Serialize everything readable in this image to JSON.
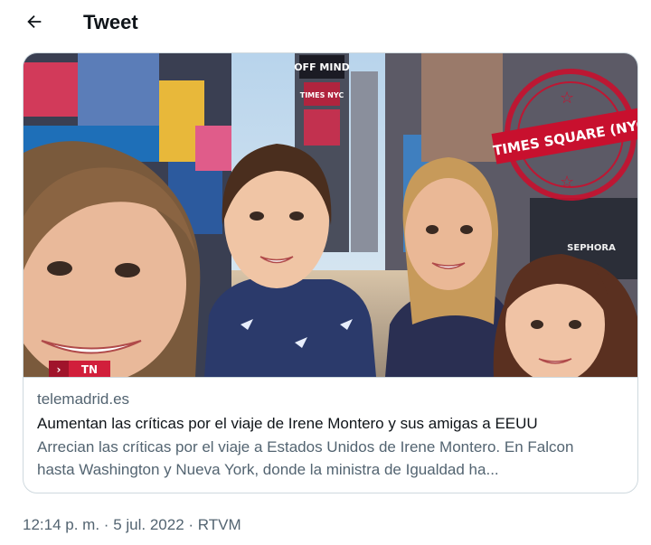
{
  "header": {
    "back_icon": "arrow-left-icon",
    "title": "Tweet"
  },
  "card": {
    "image": {
      "stamp_text": "TIMES SQUARE (NYC)",
      "sign_text_1": "OFF MIND",
      "sign_text_2": "TIMES NYC",
      "corner_logo": "TN",
      "store_sign": "SEPHORA",
      "colors": {
        "sky": "#c9dff0",
        "stamp": "#c8102e"
      }
    },
    "domain": "telemadrid.es",
    "title": "Aumentan las críticas por el viaje de Irene Montero y sus amigas a EEUU",
    "description_line1": "Arrecian las críticas por el viaje a Estados Unidos de Irene Montero. En Falcon",
    "description_line2": "hasta Washington y Nueva York, donde la ministra de Igualdad ha..."
  },
  "meta": {
    "time": "12:14 p. m.",
    "date": "5 jul. 2022",
    "source": "RTVM",
    "separator": "·"
  }
}
